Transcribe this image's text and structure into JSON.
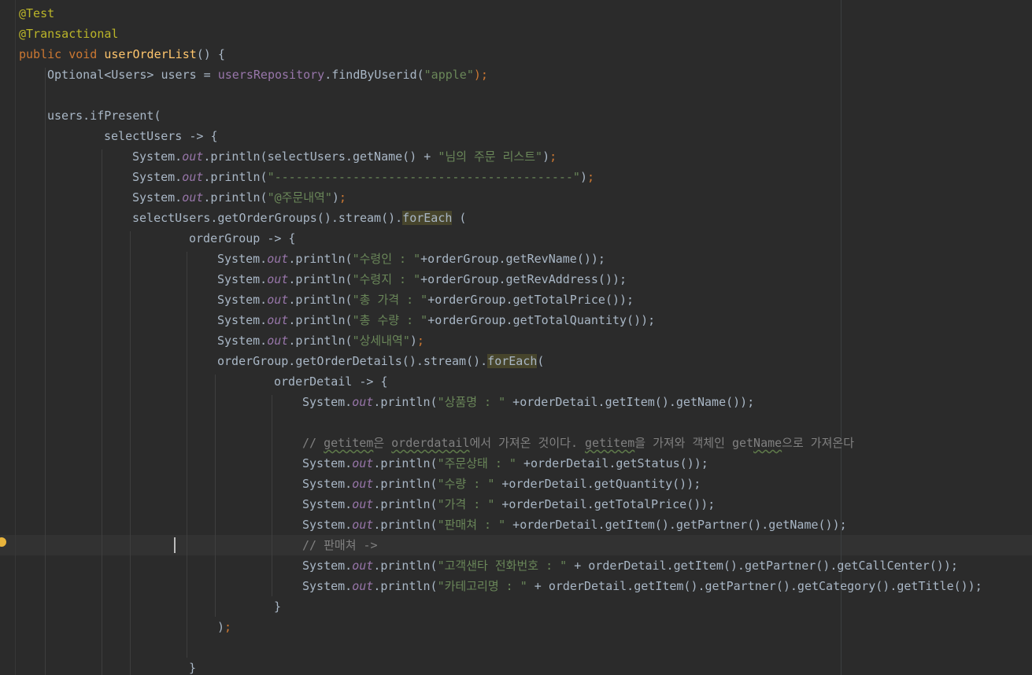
{
  "code": {
    "annotation_test": "@Test",
    "annotation_transactional": "@Transactional",
    "kw_public": "public",
    "kw_void": "void",
    "method_name": "userOrderList",
    "method_sig_rest": "() {",
    "l4_a": "Optional<Users> users = ",
    "l4_field": "usersRepository",
    "l4_b": ".findByUserid(",
    "l4_str": "\"apple\"",
    "l4_end": ");",
    "l6": "users.ifPresent(",
    "l7": "selectUsers -> {",
    "sys": "System.",
    "out": "out",
    "println": ".println(",
    "l8_a": "selectUsers.getName() + ",
    "l8_str": "\"님의 주문 리스트\"",
    "l9_str": "\"------------------------------------------\"",
    "l10_str": "\"@주문내역\"",
    "l11_a": "selectUsers.getOrderGroups().stream().",
    "l11_hl": "forEach",
    "l11_b": " (",
    "l12": "orderGroup -> {",
    "l13_str": "\"수령인 : \"",
    "l13_b": "+orderGroup.getRevName());",
    "l14_str": "\"수령지 : \"",
    "l14_b": "+orderGroup.getRevAddress());",
    "l15_str": "\"총 가격 : \"",
    "l15_b": "+orderGroup.getTotalPrice());",
    "l16_str": "\"총 수량 : \"",
    "l16_b": "+orderGroup.getTotalQuantity());",
    "l17_str": "\"상세내역\"",
    "l18_a": "orderGroup.getOrderDetails().stream().",
    "l18_hl": "forEach",
    "l18_b": "(",
    "l19": "orderDetail -> {",
    "l20_str": "\"상품명 : \"",
    "l20_b": " +orderDetail.getItem().getName());",
    "l22_c1": "// ",
    "l22_w1": "getitem",
    "l22_c2": "은 ",
    "l22_w2": "orderdatail",
    "l22_c3": "에서 가져온 것이다. ",
    "l22_w3": "getitem",
    "l22_c4": "을 가져와 객체인 get",
    "l22_w4": "Name",
    "l22_c5": "으로 가져온다",
    "l23_str": "\"주문상태 : \"",
    "l23_b": " +orderDetail.getStatus());",
    "l24_str": "\"수량 : \"",
    "l24_b": " +orderDetail.getQuantity());",
    "l25_str": "\"가격 : \"",
    "l25_b": " +orderDetail.getTotalPrice());",
    "l26_str": "\"판매쳐 : \"",
    "l26_b": " +orderDetail.getItem().getPartner().getName());",
    "l27_cmt": "// 판매쳐 ->",
    "l28_str": "\"고객샌타 전화번호 : \"",
    "l28_b": " + orderDetail.getItem().getPartner().getCallCenter());",
    "l29_str": "\"카테고리명 : \"",
    "l29_b": " + orderDetail.getItem().getPartner().getCategory().getTitle());",
    "close_brace": "}",
    "close_paren": ")",
    "semicolon": ";"
  },
  "colors": {
    "background": "#2b2b2b",
    "keyword": "#cc7832",
    "method": "#ffc66d",
    "field": "#9876aa",
    "string": "#6a8759",
    "comment": "#808080",
    "annotation": "#bbb529"
  },
  "icons": {
    "gutter": "lightbulb-icon"
  }
}
